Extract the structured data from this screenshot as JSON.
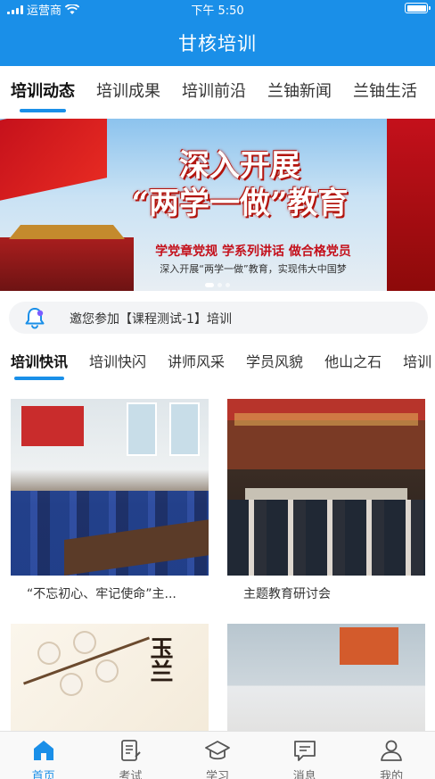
{
  "status_bar": {
    "carrier": "运营商",
    "time": "下午 5:50"
  },
  "header": {
    "title": "甘核培训"
  },
  "top_tabs": [
    {
      "label": "培训动态",
      "active": true
    },
    {
      "label": "培训成果",
      "active": false
    },
    {
      "label": "培训前沿",
      "active": false
    },
    {
      "label": "兰铀新闻",
      "active": false
    },
    {
      "label": "兰铀生活",
      "active": false
    }
  ],
  "banner": {
    "headline_line1": "深入开展",
    "headline_line2": "“两学一做”教育",
    "subtitle": "学党章党规 学系列讲话 做合格党员",
    "caption": "深入开展“两学一做”教育，实现伟大中国梦"
  },
  "notice": {
    "text": "邀您参加【课程测试-1】培训"
  },
  "sub_tabs": [
    {
      "label": "培训快讯",
      "active": true
    },
    {
      "label": "培训快闪",
      "active": false
    },
    {
      "label": "讲师风采",
      "active": false
    },
    {
      "label": "学员风貌",
      "active": false
    },
    {
      "label": "他山之石",
      "active": false
    },
    {
      "label": "培训",
      "active": false
    }
  ],
  "cards": [
    {
      "title": "“不忘初心、牢记使命”主..."
    },
    {
      "title": "主题教育研讨会"
    },
    {
      "title": "",
      "poster_text": "玉兰"
    },
    {
      "title": ""
    }
  ],
  "bottom_nav": [
    {
      "label": "首页",
      "icon": "home-icon",
      "active": true
    },
    {
      "label": "考试",
      "icon": "exam-icon",
      "active": false
    },
    {
      "label": "学习",
      "icon": "graduation-cap-icon",
      "active": false
    },
    {
      "label": "消息",
      "icon": "message-icon",
      "active": false
    },
    {
      "label": "我的",
      "icon": "user-icon",
      "active": false
    }
  ],
  "colors": {
    "primary": "#1a8fe8",
    "text": "#333333",
    "notice_bg": "#f3f4f6"
  }
}
